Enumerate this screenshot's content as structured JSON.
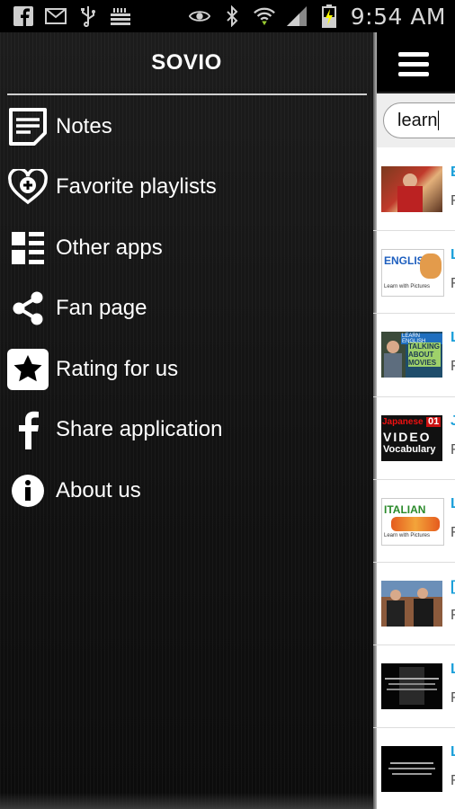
{
  "status_bar": {
    "time": "9:54 AM",
    "icons": [
      "facebook-icon",
      "email-icon",
      "usb-icon",
      "storage-icon",
      "eye-icon",
      "bluetooth-icon",
      "wifi-icon",
      "signal-icon",
      "battery-charging-icon"
    ]
  },
  "drawer": {
    "title": "SOVIO",
    "items": [
      {
        "label": "Notes",
        "icon": "notes-icon"
      },
      {
        "label": "Favorite playlists",
        "icon": "heart-plus-icon"
      },
      {
        "label": "Other apps",
        "icon": "grid-list-icon"
      },
      {
        "label": "Fan page",
        "icon": "share-icon"
      },
      {
        "label": "Rating for us",
        "icon": "star-icon"
      },
      {
        "label": "Share application",
        "icon": "facebook-icon"
      },
      {
        "label": "About us",
        "icon": "info-icon"
      }
    ]
  },
  "main": {
    "search_value": "learn",
    "rows": [
      {
        "title": "E",
        "sub": "F"
      },
      {
        "title": "L",
        "sub": "F"
      },
      {
        "title": "L",
        "sub": "F"
      },
      {
        "title": "J",
        "sub": "F"
      },
      {
        "title": "L",
        "sub": "F"
      },
      {
        "title": "[",
        "sub": "F"
      },
      {
        "title": "L",
        "sub": "F"
      },
      {
        "title": "L",
        "sub": "F"
      }
    ],
    "thumbs": {
      "english_top": "ENGLISH",
      "english_bottom": "Learn with Pictures",
      "talking_top": "LEARN ENGLISH",
      "talking_bottom": "TALKING ABOUT MOVIES",
      "japanese_top": "Japanese",
      "japanese_num": "01",
      "japanese_video": "VIDEO",
      "japanese_vocab": "Vocabulary",
      "italian_top": "ITALIAN",
      "italian_bottom": "Learn with Pictures"
    }
  },
  "colors": {
    "accent": "#1a9fd9",
    "drawer_bg": "#141414"
  }
}
